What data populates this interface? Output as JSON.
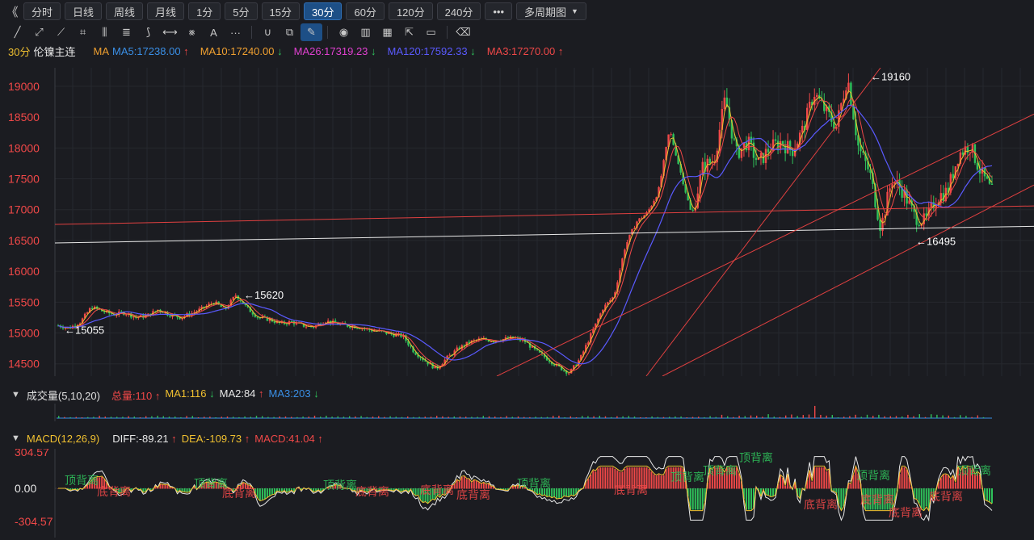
{
  "toolbar": {
    "collapse": "《",
    "periods": [
      "分时",
      "日线",
      "周线",
      "月线",
      "1分",
      "5分",
      "15分",
      "30分",
      "60分",
      "120分",
      "240分"
    ],
    "active_period": "30分",
    "more": "•••",
    "multi_period": "多周期图"
  },
  "drawing_tools": [
    "line-tool-icon",
    "ray-tool-icon",
    "polyline-tool-icon",
    "crop-tool-icon",
    "fib-tool-icon",
    "channel-tool-icon",
    "brush-tool-icon",
    "measure-tool-icon",
    "gann-tool-icon",
    "text-tool-icon",
    "more-tools-icon",
    "magnet-icon",
    "copy-icon",
    "pen-icon",
    "eye-icon",
    "trash-icon",
    "layout-icon",
    "share-icon",
    "comment-icon",
    "eraser-icon"
  ],
  "instrument": {
    "period": "30分",
    "name": "伦镍主连"
  },
  "ma_legend": {
    "label": "MA",
    "items": [
      {
        "text": "MA5:17238.00",
        "color": "#3a8fe6",
        "arrow": "↑",
        "dir": "up"
      },
      {
        "text": "MA10:17240.00",
        "color": "#f0a030",
        "arrow": "↓",
        "dir": "dn"
      },
      {
        "text": "MA26:17319.23",
        "color": "#e040d0",
        "arrow": "↓",
        "dir": "dn"
      },
      {
        "text": "MA120:17592.33",
        "color": "#5a5aff",
        "arrow": "↓",
        "dir": "dn"
      },
      {
        "text": "MA3:17270.00",
        "color": "#f04848",
        "arrow": "↑",
        "dir": "up"
      }
    ]
  },
  "price_axis": {
    "ticks": [
      19000,
      18500,
      18000,
      17500,
      17000,
      16500,
      16000,
      15500,
      15000,
      14500
    ],
    "color": "#f04848"
  },
  "annotations": [
    {
      "text": "←19160",
      "price": 19160
    },
    {
      "text": "←16495",
      "price": 16495
    },
    {
      "text": "←15620",
      "price": 15620
    },
    {
      "text": "←15055",
      "price": 15055
    }
  ],
  "volume_legend": {
    "title": "成交量(5,10,20)",
    "items": [
      {
        "text": "总量:110",
        "color": "#f04848",
        "arrow": "↑",
        "dir": "up"
      },
      {
        "text": "MA1:116",
        "color": "#f0c030",
        "arrow": "↓",
        "dir": "dn"
      },
      {
        "text": "MA2:84",
        "color": "#e8e8e8",
        "arrow": "↑",
        "dir": "up"
      },
      {
        "text": "MA3:203",
        "color": "#3a8fe6",
        "arrow": "↓",
        "dir": "dn"
      }
    ]
  },
  "macd_legend": {
    "title": "MACD(12,26,9)",
    "items": [
      {
        "text": "DIFF:-89.21",
        "color": "#e8e8e8",
        "arrow": "↑",
        "dir": "up"
      },
      {
        "text": "DEA:-109.73",
        "color": "#f0c030",
        "arrow": "↑",
        "dir": "up"
      },
      {
        "text": "MACD:41.04",
        "color": "#f04848",
        "arrow": "↑",
        "dir": "up"
      }
    ]
  },
  "macd_axis": {
    "top": "304.57",
    "mid": "0.00",
    "bottom": "-304.57"
  },
  "divergence_labels": {
    "top": "顶背离",
    "bottom": "底背离"
  },
  "colors": {
    "up": "#f04848",
    "down": "#2fc25b",
    "background": "#1b1c21",
    "grid": "#2a2c33"
  },
  "chart_data": {
    "type": "candlestick",
    "price_range": [
      14300,
      19300
    ],
    "close_path": [
      15120,
      15080,
      15180,
      15420,
      15350,
      15300,
      15330,
      15250,
      15280,
      15380,
      15300,
      15250,
      15320,
      15400,
      15500,
      15380,
      15620,
      15400,
      15250,
      15220,
      15150,
      15180,
      15120,
      15100,
      15200,
      15150,
      15120,
      15100,
      15050,
      15020,
      14980,
      14950,
      14700,
      14550,
      14420,
      14600,
      14750,
      14850,
      14900,
      14880,
      14900,
      14920,
      14860,
      14700,
      14580,
      14450,
      14350,
      14600,
      15000,
      15400,
      15600,
      16400,
      16800,
      16950,
      17300,
      18300,
      17600,
      16900,
      17700,
      17800,
      18800,
      17900,
      18100,
      17750,
      18000,
      18100,
      17950,
      18300,
      18900,
      18600,
      18350,
      19160,
      18000,
      17600,
      16700,
      17500,
      17300,
      16900,
      16800,
      17200,
      17300,
      17900,
      18050,
      17600,
      17280
    ],
    "support_levels": [
      16495,
      16800
    ]
  }
}
